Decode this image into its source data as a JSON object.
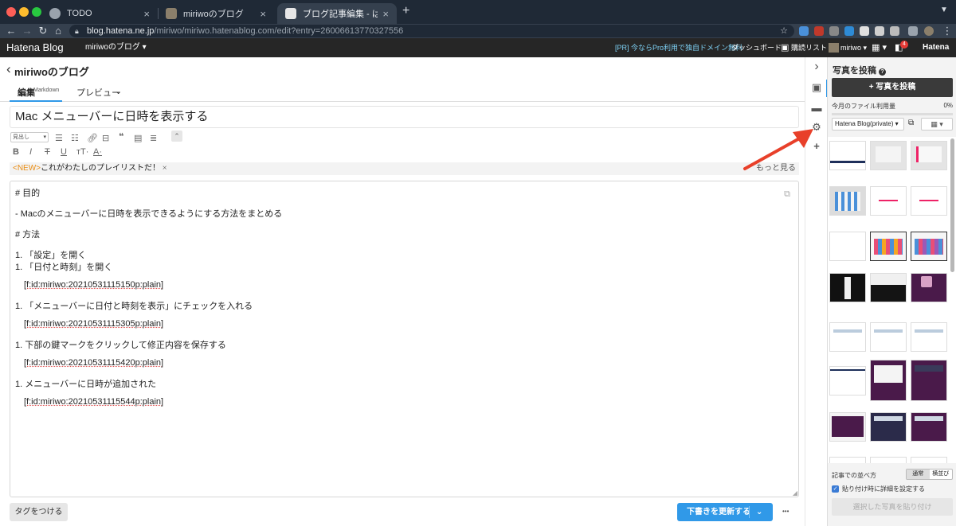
{
  "browser": {
    "tabs": [
      {
        "title": "TODO"
      },
      {
        "title": "miriwoのブログ"
      },
      {
        "title": "ブログ記事編集 - はてなブログ"
      }
    ],
    "new_tab_label": "+",
    "url_host": "blog.hatena.ne.jp",
    "url_path": "/miriwo/miriwo.hatenablog.com/edit?entry=26006613770327556"
  },
  "hatena_bar": {
    "logo": "Hatena Blog",
    "blog_selector": "miriwoのブログ ▾",
    "promo": "[PR] 今ならPro利用で独自ドメイン無料",
    "dashboard": "ダッシュボード",
    "subscriptions": "購読リスト",
    "user": "miriwo ▾",
    "notification_count": "4",
    "hatena": "Hatena"
  },
  "editor": {
    "back_label": "‹",
    "blog_name": "miriwoのブログ",
    "tab_edit": "編集",
    "tab_edit_mode": "Markdown",
    "tab_preview": "プレビュー",
    "title": "Mac メニューバーに日時を表示する",
    "heading_select": "見出し",
    "notice_new": "<NEW>",
    "notice_text": "これがわたしのプレイリストだ！",
    "notice_more": "もっと見る",
    "body_lines": [
      "# 目的",
      "- Macのメニューバーに日時を表示できるようにする方法をまとめる",
      "# 方法",
      "1. 「設定」を開く",
      "1. 「日付と時刻」を開く",
      "[f:id:miriwo:20210531115150p:plain]",
      "1. 「メニューバーに日付と時刻を表示」にチェックを入れる",
      "[f:id:miriwo:20210531115305p:plain]",
      "1. 下部の鍵マークをクリックして修正内容を保存する",
      "[f:id:miriwo:20210531115420p:plain]",
      "1. メニューバーに日時が追加された",
      "[f:id:miriwo:20210531115544p:plain]"
    ],
    "tag_button": "タグをつける",
    "save_button": "下書きを更新する",
    "more_label": "•••"
  },
  "panel": {
    "title": "写真を投稿",
    "upload_button": "+ 写真を投稿",
    "usage_label": "今月のファイル利用量",
    "usage_value": "0%",
    "album": "Hatena Blog(private)",
    "order_label": "記事での並べ方",
    "order_options": [
      "通常",
      "横並び"
    ],
    "detail_label": "貼り付け時に詳細を設定する",
    "paste_button": "選択した写真を貼り付け"
  },
  "colors": {
    "accent_blue": "#3099e8",
    "annotation_arrow": "#e8402a",
    "new_badge": "#e98d14"
  }
}
